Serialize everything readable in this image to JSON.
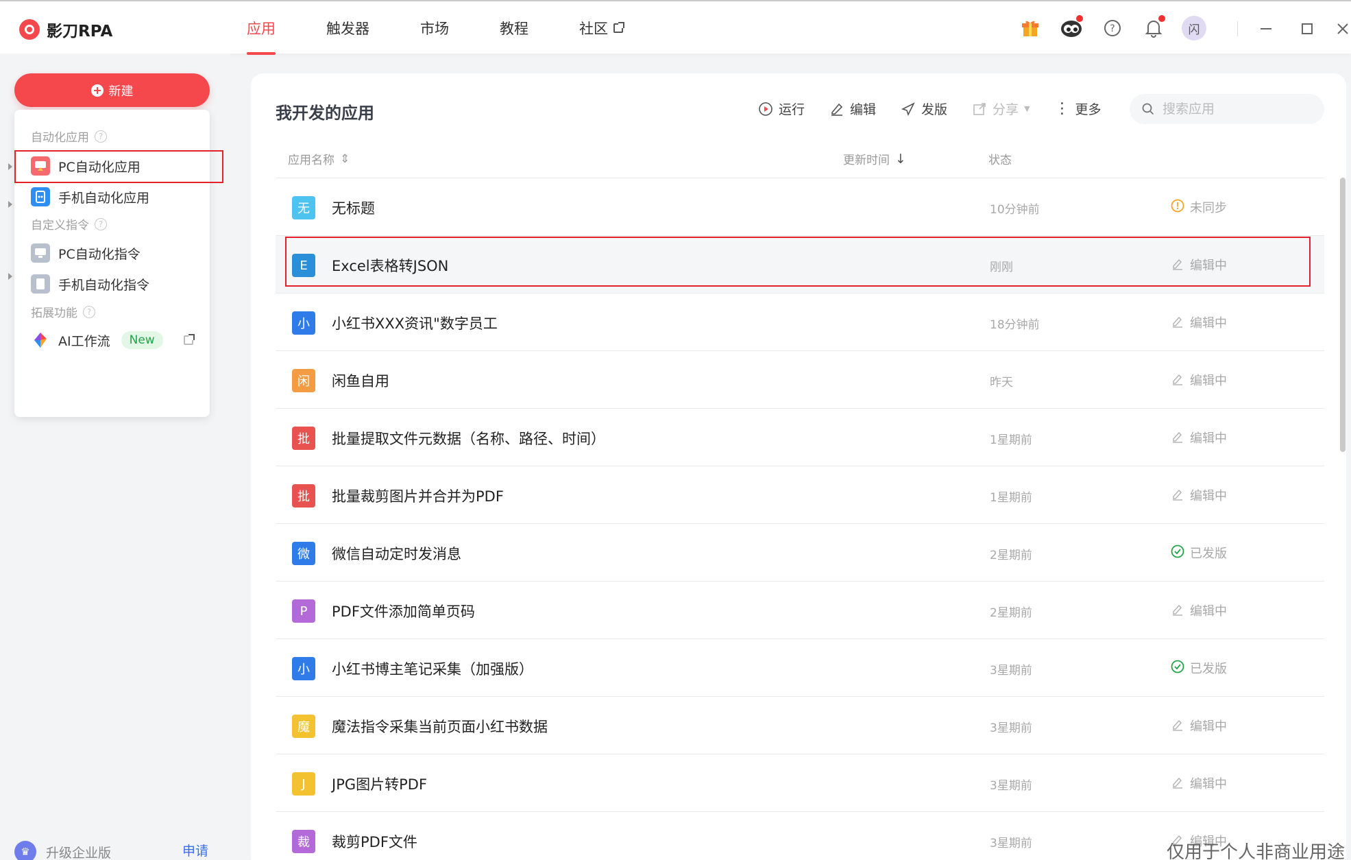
{
  "app": {
    "name": "影刀RPA"
  },
  "nav": [
    {
      "label": "应用",
      "active": true
    },
    {
      "label": "触发器",
      "active": false
    },
    {
      "label": "市场",
      "active": false
    },
    {
      "label": "教程",
      "active": false
    },
    {
      "label": "社区",
      "active": false,
      "external": true
    }
  ],
  "header_icons": [
    "gift-icon",
    "eye-mascot-icon",
    "help-icon",
    "bell-icon"
  ],
  "user": {
    "avatar_text": "闪"
  },
  "sidebar": {
    "new_label": "新建",
    "group_auto": "自动化应用",
    "group_custom": "自定义指令",
    "group_ext": "拓展功能",
    "item_pc_app": "PC自动化应用",
    "item_mobile_app": "手机自动化应用",
    "item_pc_cmd": "PC自动化指令",
    "item_mobile_cmd": "手机自动化指令",
    "item_ai": "AI工作流",
    "new_badge": "New",
    "upgrade_label": "升级企业版",
    "apply_label": "申请"
  },
  "main": {
    "title": "我开发的应用",
    "toolbar": {
      "run": "运行",
      "edit": "编辑",
      "publish": "发版",
      "share": "分享",
      "more": "更多"
    },
    "search_placeholder": "搜索应用",
    "columns": {
      "name": "应用名称",
      "time": "更新时间",
      "status": "状态"
    }
  },
  "colors": {
    "brand": "#f4484d",
    "selection": "#e5202a"
  },
  "apps": [
    {
      "icon": "无",
      "color": "#4ec3f0",
      "name": "无标题",
      "time": "10分钟前",
      "status": "未同步",
      "status_type": "warn"
    },
    {
      "icon": "E",
      "color": "#2a8ed8",
      "name": "Excel表格转JSON",
      "time": "刚刚",
      "status": "编辑中",
      "status_type": "edit",
      "selected": true
    },
    {
      "icon": "小",
      "color": "#2f7ce8",
      "name": "小红书XXX资讯\"数字员工",
      "time": "18分钟前",
      "status": "编辑中",
      "status_type": "edit"
    },
    {
      "icon": "闲",
      "color": "#f39c44",
      "name": "闲鱼自用",
      "time": "昨天",
      "status": "编辑中",
      "status_type": "edit"
    },
    {
      "icon": "批",
      "color": "#e9534f",
      "name": "批量提取文件元数据（名称、路径、时间）",
      "time": "1星期前",
      "status": "编辑中",
      "status_type": "edit"
    },
    {
      "icon": "批",
      "color": "#e9534f",
      "name": "批量裁剪图片并合并为PDF",
      "time": "1星期前",
      "status": "编辑中",
      "status_type": "edit"
    },
    {
      "icon": "微",
      "color": "#2f7ce8",
      "name": "微信自动定时发消息",
      "time": "2星期前",
      "status": "已发版",
      "status_type": "ok"
    },
    {
      "icon": "P",
      "color": "#b36ad8",
      "name": "PDF文件添加简单页码",
      "time": "2星期前",
      "status": "编辑中",
      "status_type": "edit"
    },
    {
      "icon": "小",
      "color": "#2f7ce8",
      "name": "小红书博主笔记采集（加强版）",
      "time": "3星期前",
      "status": "已发版",
      "status_type": "ok"
    },
    {
      "icon": "魔",
      "color": "#f2c230",
      "name": "魔法指令采集当前页面小红书数据",
      "time": "3星期前",
      "status": "编辑中",
      "status_type": "edit"
    },
    {
      "icon": "J",
      "color": "#f2c230",
      "name": "JPG图片转PDF",
      "time": "3星期前",
      "status": "编辑中",
      "status_type": "edit"
    },
    {
      "icon": "裁",
      "color": "#b36ad8",
      "name": "裁剪PDF文件",
      "time": "3星期前",
      "status": "编辑中",
      "status_type": "edit"
    }
  ],
  "watermark": "仅用于个人非商业用途"
}
